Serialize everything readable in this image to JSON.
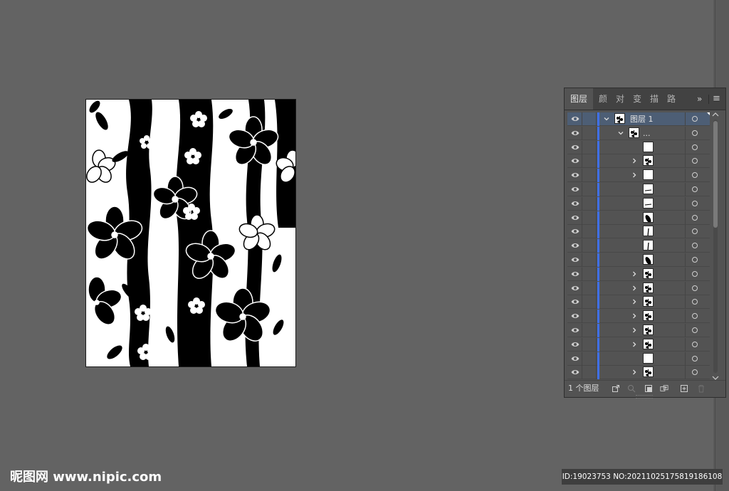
{
  "panel": {
    "tabs": [
      {
        "label": "图层",
        "active": true
      },
      {
        "label": "颜"
      },
      {
        "label": "对"
      },
      {
        "label": "变"
      },
      {
        "label": "描"
      },
      {
        "label": "路"
      }
    ],
    "more_label": "»",
    "menu_icon": "hamburger-menu-icon",
    "layer_count": "1 个图层",
    "accent_color": "#3f6fe6",
    "selected_row_color": "#4d5e75",
    "layers": [
      {
        "name": "图层 1",
        "depth": 0,
        "expanded": true,
        "selected": true
      },
      {
        "name": "...",
        "depth": 1,
        "expanded": true
      },
      {
        "thumb": "blank",
        "depth": 2
      },
      {
        "thumb": "flower",
        "depth": 2,
        "collapsed": true
      },
      {
        "thumb": "blank",
        "depth": 2,
        "collapsed": true
      },
      {
        "thumb": "line",
        "depth": 2
      },
      {
        "thumb": "line",
        "depth": 2
      },
      {
        "thumb": "leaf",
        "depth": 2
      },
      {
        "thumb": "stem",
        "depth": 2
      },
      {
        "thumb": "stem",
        "depth": 2
      },
      {
        "thumb": "leaf",
        "depth": 2
      },
      {
        "thumb": "flower",
        "depth": 2,
        "collapsed": true
      },
      {
        "thumb": "flower",
        "depth": 2,
        "collapsed": true
      },
      {
        "thumb": "flower",
        "depth": 2,
        "collapsed": true
      },
      {
        "thumb": "flower",
        "depth": 2,
        "collapsed": true
      },
      {
        "thumb": "flower",
        "depth": 2,
        "collapsed": true
      },
      {
        "thumb": "flower",
        "depth": 2,
        "collapsed": true
      },
      {
        "thumb": "blank",
        "depth": 2
      },
      {
        "thumb": "flower",
        "depth": 2,
        "collapsed": true
      }
    ]
  },
  "watermark": {
    "logo": "昵图网 www.nipic.com",
    "id_text": "ID:19023753 NO:20211025175819186108"
  }
}
